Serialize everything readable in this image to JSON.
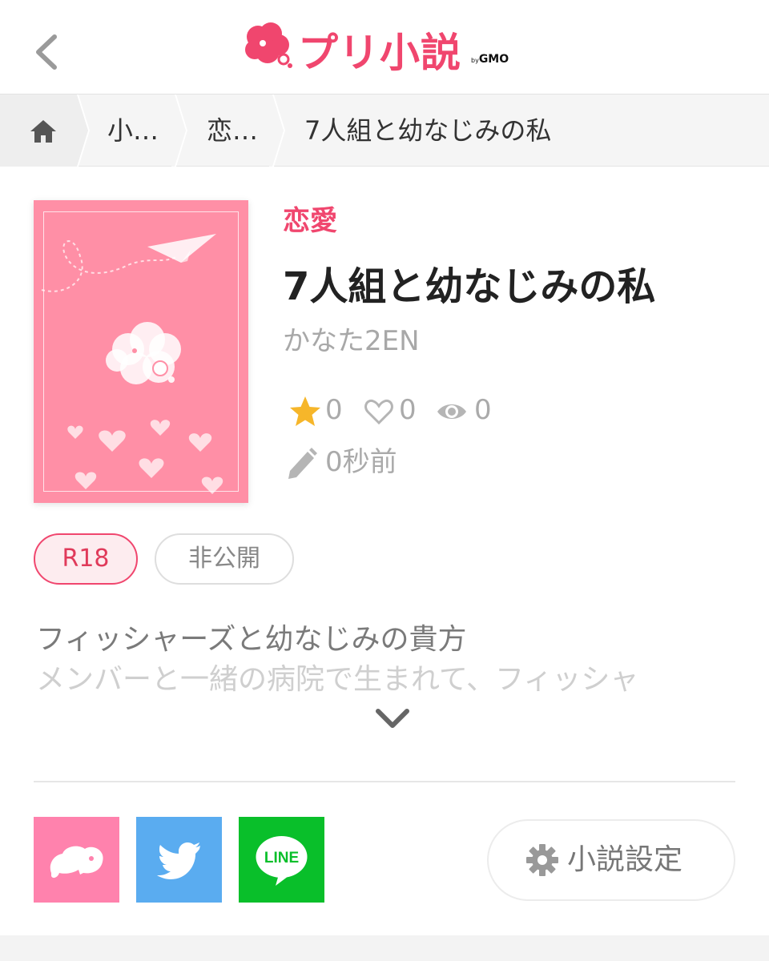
{
  "header": {
    "logo_text": "プリ小説",
    "logo_by": "by",
    "logo_company": "GMO"
  },
  "breadcrumb": {
    "items": [
      "小…",
      "恋…",
      "7人組と幼なじみの私"
    ]
  },
  "novel": {
    "category": "恋愛",
    "title": "7人組と幼なじみの私",
    "author": "かなた2EN",
    "stats": {
      "stars": "0",
      "likes": "0",
      "views": "0"
    },
    "updated": "0秒前",
    "tags": [
      "R18",
      "非公開"
    ],
    "description": [
      "フィッシャーズと幼なじみの貴方",
      "メンバーと一緒の病院で生まれて、フィッシャ"
    ]
  },
  "actions": {
    "settings_label": "小説設定"
  },
  "colors": {
    "brand": "#f0466e",
    "cover": "#ff8fa6",
    "twitter": "#5aacf0",
    "line": "#09bf2a",
    "prcm": "#ff82ad",
    "star": "#f6b62a"
  },
  "icons": [
    "back-chevron-icon",
    "home-icon",
    "star-icon",
    "heart-icon",
    "eye-icon",
    "pencil-icon",
    "chevron-down-icon",
    "prcm-elephant-icon",
    "twitter-bird-icon",
    "line-logo-icon",
    "gear-icon"
  ]
}
